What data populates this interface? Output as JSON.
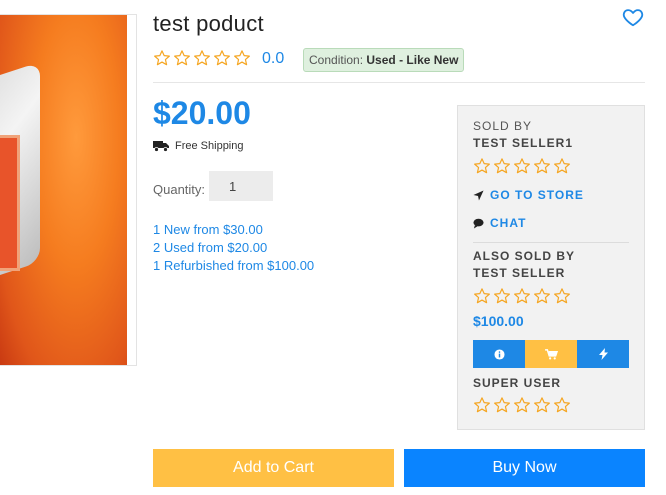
{
  "product": {
    "title": "test poduct",
    "rating_value": "0.0",
    "rating_stars": 0,
    "condition_label": "Condition:",
    "condition_value": "Used - Like New",
    "price": "$20.00",
    "shipping": "Free Shipping",
    "quantity_label": "Quantity:",
    "quantity_value": "1"
  },
  "offers": [
    "1 New from $30.00",
    "2 Used from $20.00",
    "1 Refurbished from $100.00"
  ],
  "seller_panel": {
    "sold_by_caption": "SOLD BY",
    "seller_name": "TEST SELLER1",
    "seller_stars": 0,
    "go_to_store": "GO TO STORE",
    "chat": "CHAT",
    "also_sold_caption": "ALSO SOLD BY",
    "also_seller_name": "TEST SELLER",
    "also_seller_stars": 0,
    "also_seller_price": "$100.00",
    "super_user_name": "SUPER USER",
    "super_user_stars": 0,
    "action_colors": [
      "#1e88e5",
      "#ffc044",
      "#1e88e5"
    ],
    "action_icons": [
      "info-icon",
      "cart-icon",
      "bolt-icon"
    ]
  },
  "actions": {
    "add_to_cart": "Add to Cart",
    "buy_now": "Buy Now"
  },
  "colors": {
    "accent": "#1e88e5",
    "star": "#f5a623",
    "cart_button": "#ffc044",
    "buy_button": "#0a84ff"
  },
  "icons": {
    "wishlist": "heart-outline-icon",
    "shipping": "truck-icon",
    "store": "location-arrow-icon",
    "chat": "chat-bubble-icon",
    "star": "star-outline-icon"
  }
}
